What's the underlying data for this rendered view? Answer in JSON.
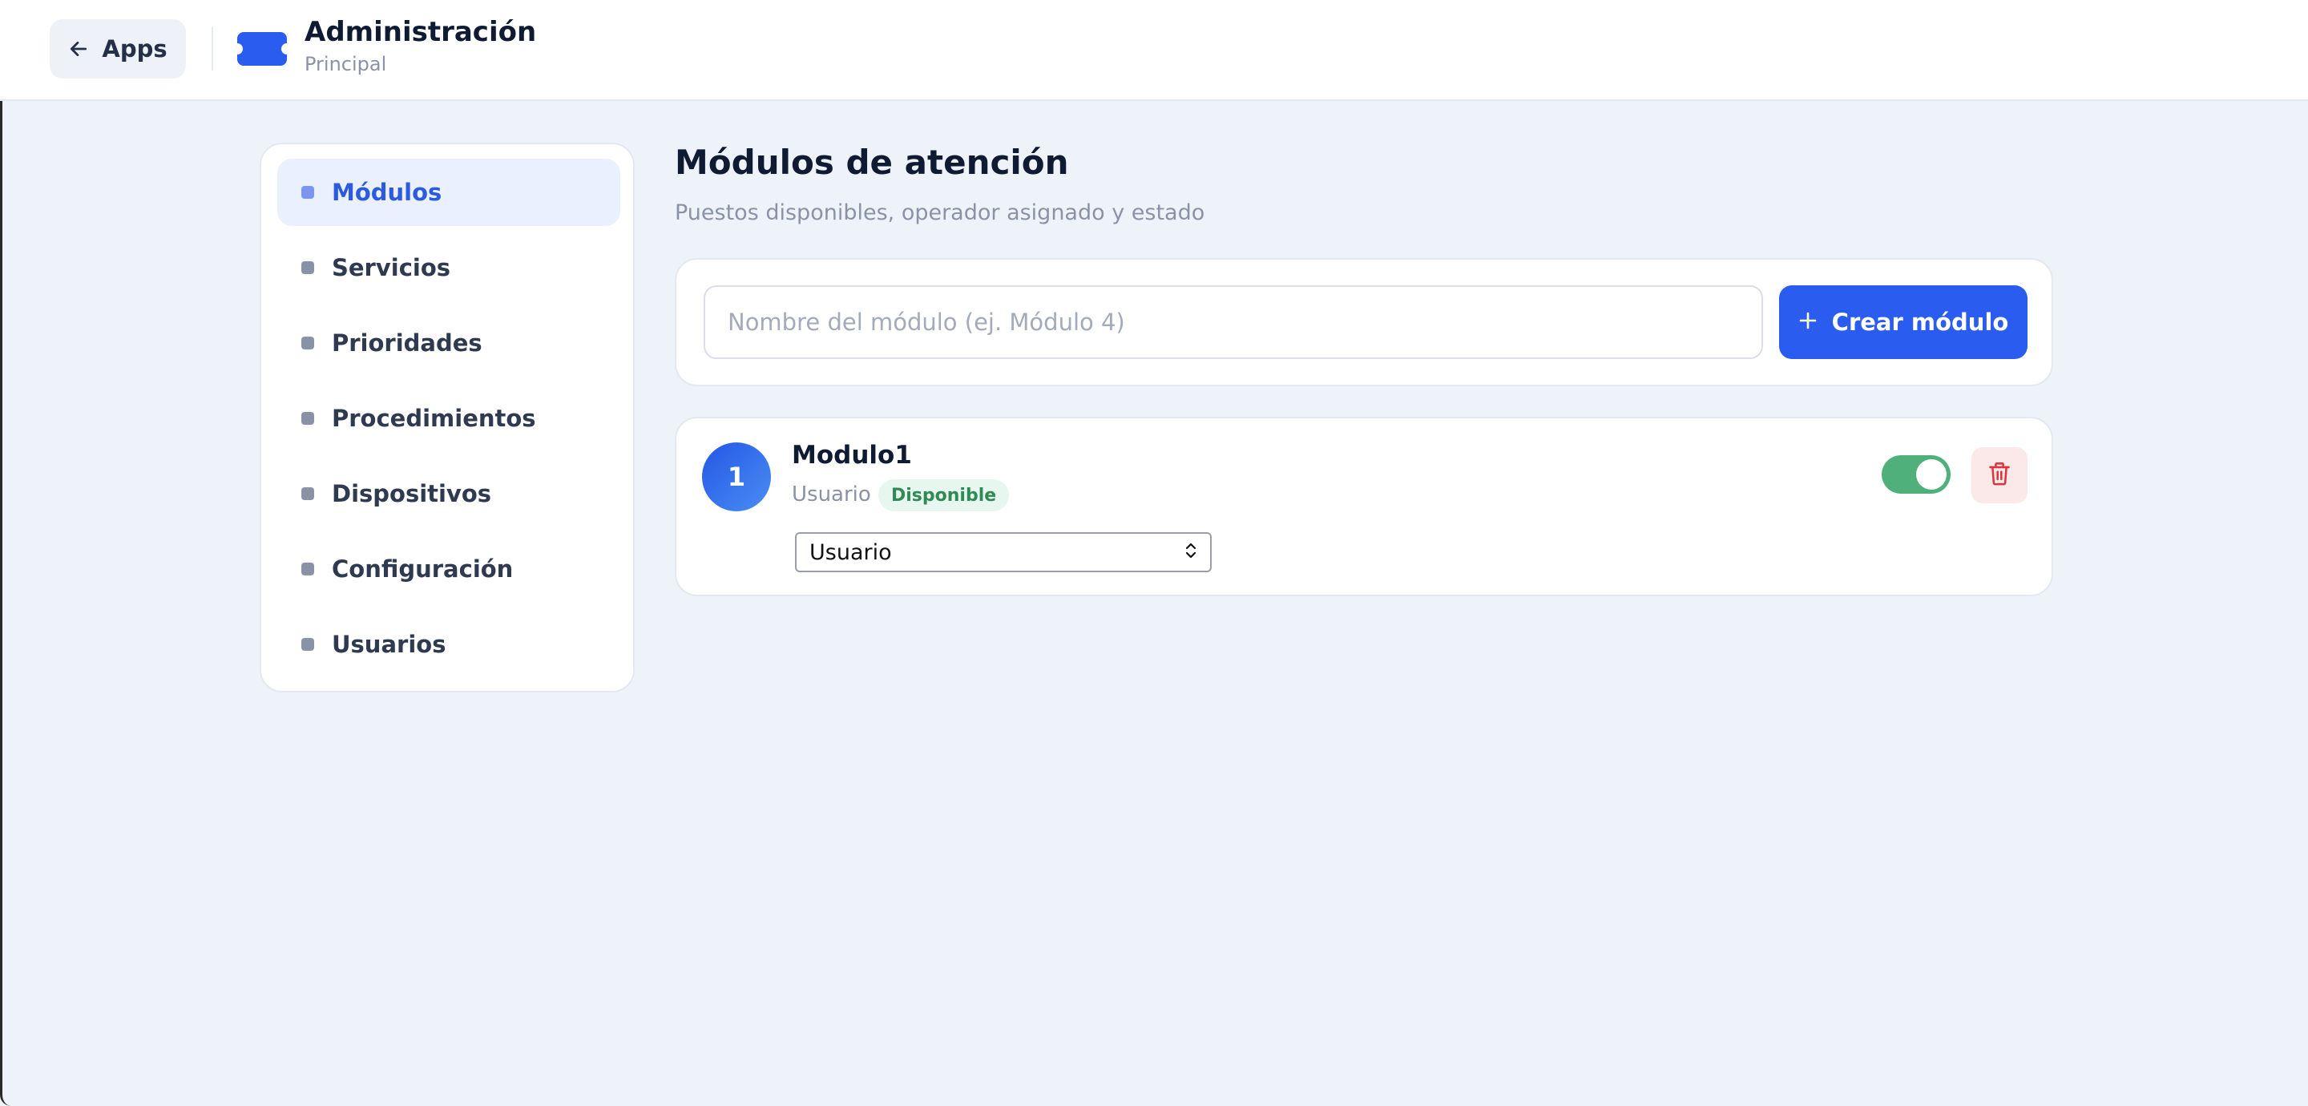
{
  "header": {
    "back_label": "Apps",
    "title": "Administración",
    "subtitle": "Principal"
  },
  "sidebar": {
    "items": [
      {
        "label": "Módulos",
        "active": true
      },
      {
        "label": "Servicios",
        "active": false
      },
      {
        "label": "Prioridades",
        "active": false
      },
      {
        "label": "Procedimientos",
        "active": false
      },
      {
        "label": "Dispositivos",
        "active": false
      },
      {
        "label": "Configuración",
        "active": false
      },
      {
        "label": "Usuarios",
        "active": false
      }
    ]
  },
  "main": {
    "title": "Módulos de atención",
    "subtitle": "Puestos disponibles, operador asignado y estado",
    "create": {
      "input_value": "",
      "input_placeholder": "Nombre del módulo (ej. Módulo 4)",
      "button_label": "Crear módulo"
    },
    "modules": [
      {
        "number": "1",
        "name": "Modulo1",
        "operator": "Usuario",
        "status": "Disponible",
        "select_value": "Usuario",
        "enabled": true
      }
    ]
  },
  "colors": {
    "accent": "#2b5cf0",
    "active_nav_text": "#2c5be0",
    "status_green": "#2f8a55",
    "toggle_on": "#4fb07c",
    "delete_red": "#d9363e",
    "background": "#eef2f9"
  },
  "icons": {
    "back": "arrow-left-icon",
    "logo": "ticket-icon",
    "create": "plus-icon",
    "select": "chevron-up-down-icon",
    "delete": "trash-icon"
  }
}
